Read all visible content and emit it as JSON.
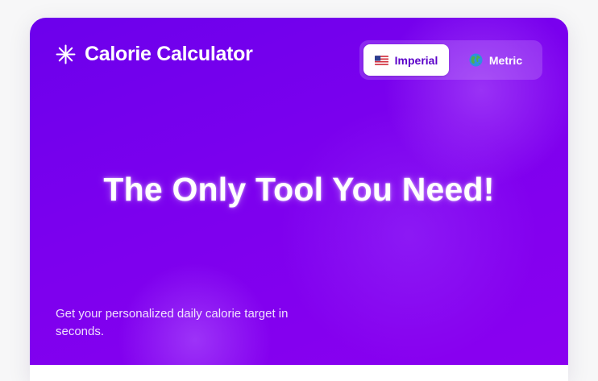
{
  "header": {
    "title": "Calorie Calculator",
    "icon": "asterisk-sparkle-icon"
  },
  "unit_toggle": {
    "options": [
      {
        "label": "Imperial",
        "icon": "us-flag-icon",
        "selected": true
      },
      {
        "label": "Metric",
        "icon": "globe-icon",
        "selected": false
      }
    ]
  },
  "hero": {
    "headline": "The Only Tool You Need!",
    "subtitle": "Get your personalized daily calorie target in seconds."
  },
  "colors": {
    "accent": "#7a00ee",
    "accent_dark": "#5b00c9",
    "text_on_accent": "#ffffff",
    "page_background": "#f7f7f8"
  }
}
